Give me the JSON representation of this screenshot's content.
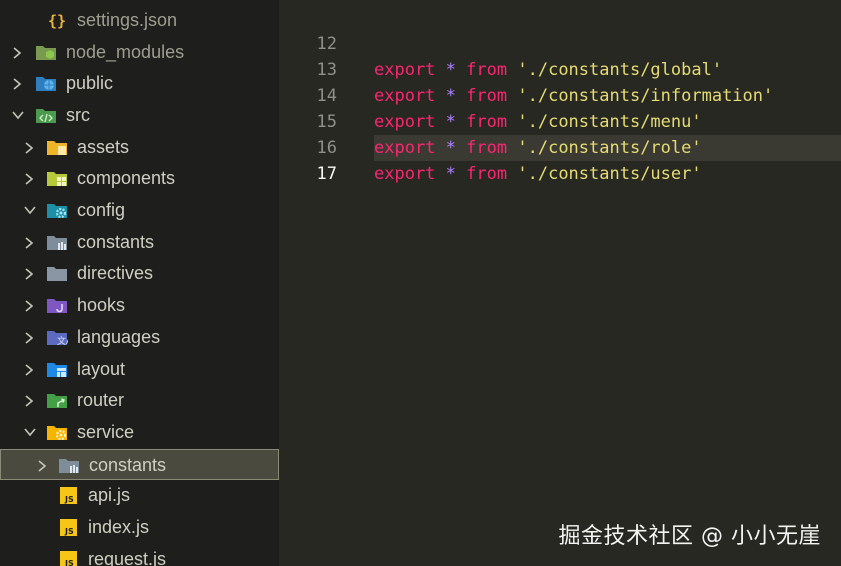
{
  "explorer": {
    "rows": [
      {
        "label": "settings.json",
        "icon": "json-braces-icon",
        "expanded": null,
        "muted": true
      },
      {
        "label": "node_modules",
        "icon": "node-folder-icon",
        "expanded": false,
        "muted": true
      },
      {
        "label": "public",
        "icon": "public-folder-icon",
        "expanded": false
      },
      {
        "label": "src",
        "icon": "src-folder-icon",
        "expanded": true
      },
      {
        "label": "assets",
        "icon": "assets-folder-icon",
        "expanded": false
      },
      {
        "label": "components",
        "icon": "components-folder-icon",
        "expanded": false
      },
      {
        "label": "config",
        "icon": "config-folder-icon",
        "expanded": true
      },
      {
        "label": "constants",
        "icon": "constants-folder-icon",
        "expanded": false
      },
      {
        "label": "directives",
        "icon": "folder-icon",
        "expanded": false
      },
      {
        "label": "hooks",
        "icon": "hooks-folder-icon",
        "expanded": false
      },
      {
        "label": "languages",
        "icon": "languages-folder-icon",
        "expanded": false
      },
      {
        "label": "layout",
        "icon": "layout-folder-icon",
        "expanded": false
      },
      {
        "label": "router",
        "icon": "router-folder-icon",
        "expanded": false
      },
      {
        "label": "service",
        "icon": "service-folder-icon",
        "expanded": true
      },
      {
        "label": "constants",
        "icon": "constants-folder-icon",
        "expanded": false,
        "selected": true
      },
      {
        "label": "api.js",
        "icon": "js-file-icon",
        "expanded": null
      },
      {
        "label": "index.js",
        "icon": "js-file-icon",
        "expanded": null
      },
      {
        "label": "request.js",
        "icon": "js-file-icon",
        "expanded": null
      }
    ]
  },
  "editor": {
    "active_line": "17",
    "lines": [
      {
        "number": "12",
        "keyword": "export",
        "star": "*",
        "from": "from",
        "path": "'./constants/global'"
      },
      {
        "number": "13",
        "keyword": "export",
        "star": "*",
        "from": "from",
        "path": "'./constants/information'"
      },
      {
        "number": "14",
        "keyword": "export",
        "star": "*",
        "from": "from",
        "path": "'./constants/menu'"
      },
      {
        "number": "15",
        "keyword": "export",
        "star": "*",
        "from": "from",
        "path": "'./constants/role'"
      },
      {
        "number": "16",
        "keyword": "export",
        "star": "*",
        "from": "from",
        "path": "'./constants/user'"
      },
      {
        "number": "17",
        "keyword": "",
        "star": "",
        "from": "",
        "path": ""
      }
    ]
  },
  "watermark": "掘金技术社区 @ 小小无崖",
  "colors": {
    "keyword": "#f92672",
    "operator": "#ae81ff",
    "string": "#e6db74",
    "editor_bg": "#272822",
    "sidebar_bg": "#1e1f1c",
    "selection": "#4b4a3f"
  }
}
